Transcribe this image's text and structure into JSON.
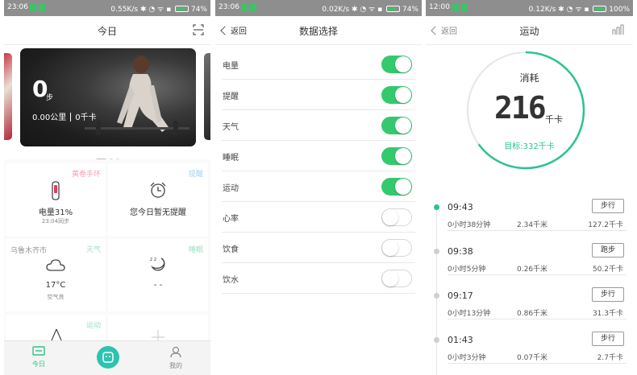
{
  "panel1": {
    "status": {
      "time": "23:06",
      "speed": "0.55K/s",
      "battery": "74%",
      "battery_level": 0.74
    },
    "title": "今日",
    "icons": {
      "scan": "scan-icon"
    },
    "banner": {
      "steps": "0",
      "steps_unit": "步",
      "distance": "0.00公里",
      "calories": "0千卡"
    },
    "cards": {
      "band": {
        "tag": "黄卷手环",
        "main": "电量31%",
        "sub": "23:04同步",
        "tag_color": "#f5a0b0"
      },
      "reminder": {
        "tag": "提醒",
        "main": "您今日暂无提醒",
        "tag_color": "#9ed0f5"
      },
      "weather": {
        "city": "乌鲁木齐市",
        "tag": "天气",
        "main": "17°C",
        "sub": "空气良",
        "tag_color": "#9fe0c0"
      },
      "sleep": {
        "tag": "睡眠",
        "main": "- -",
        "tag_color": "#9fe0c0"
      },
      "sport": {
        "tag": "运动",
        "tag_color": "#9fe0c0"
      }
    },
    "tabs": {
      "today": "今日",
      "mine": "我的"
    }
  },
  "panel2": {
    "status": {
      "time": "23:06",
      "speed": "0.02K/s",
      "battery": "74%",
      "battery_level": 0.74
    },
    "back": "返回",
    "title": "数据选择",
    "rows": [
      {
        "label": "电量",
        "on": true
      },
      {
        "label": "提醒",
        "on": true
      },
      {
        "label": "天气",
        "on": true
      },
      {
        "label": "睡眠",
        "on": true
      },
      {
        "label": "运动",
        "on": true
      },
      {
        "label": "心率",
        "on": false
      },
      {
        "label": "饮食",
        "on": false
      },
      {
        "label": "饮水",
        "on": false
      }
    ]
  },
  "panel3": {
    "status": {
      "time": "12:00",
      "speed": "0.12K/s",
      "battery": "100%",
      "battery_level": 1.0
    },
    "back": "返回",
    "title": "运动",
    "ring": {
      "label": "消耗",
      "value": "216",
      "unit": "千卡",
      "goal": "目标:332千卡",
      "progress": 0.65
    },
    "entries": [
      {
        "time": "09:43",
        "type": "步行",
        "duration": "0小时38分钟",
        "distance": "2.34千米",
        "calories": "127.2千卡",
        "active": true
      },
      {
        "time": "09:38",
        "type": "跑步",
        "duration": "0小时5分钟",
        "distance": "0.26千米",
        "calories": "50.2千卡",
        "active": false
      },
      {
        "time": "09:17",
        "type": "步行",
        "duration": "0小时13分钟",
        "distance": "0.86千米",
        "calories": "31.3千卡",
        "active": false
      },
      {
        "time": "01:43",
        "type": "步行",
        "duration": "0小时3分钟",
        "distance": "0.07千米",
        "calories": "2.7千卡",
        "active": false
      }
    ]
  },
  "colors": {
    "accent": "#2cc38a",
    "toggle_on": "#35c96e"
  }
}
